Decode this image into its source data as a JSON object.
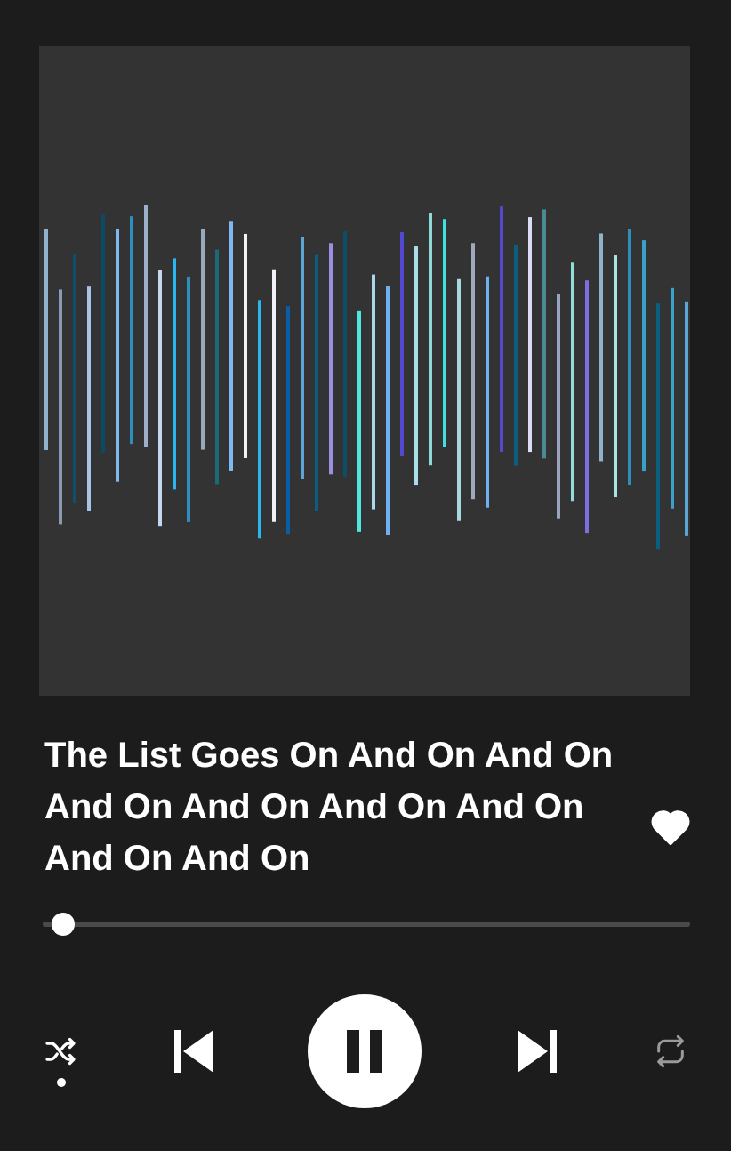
{
  "track": {
    "title": "The List Goes On And On And On And On And On And On And On And On And On",
    "liked": true
  },
  "progress": {
    "level": 0.02
  },
  "controls": {
    "shuffle": {
      "on": true
    },
    "playing": true,
    "repeat": {
      "on": false
    }
  }
}
